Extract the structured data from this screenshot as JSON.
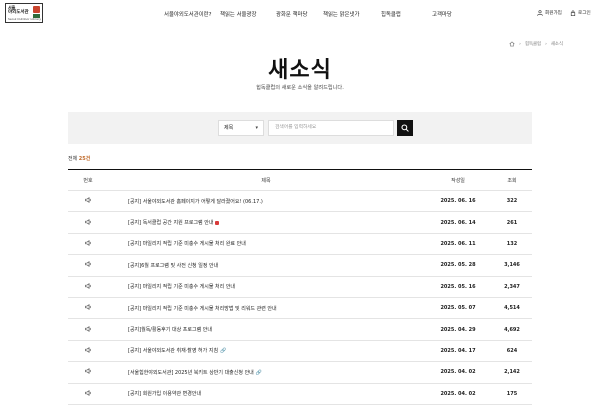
{
  "header": {
    "logo": {
      "line1": "서울",
      "line2": "야외도서관",
      "line3": "Seoul Outdoor Library"
    },
    "nav": [
      "서울야외도서관이란?",
      "책읽는 서울광장",
      "광화문 책마당",
      "책읽는 맑은냇가",
      "힙독클럽",
      "고객마당"
    ],
    "util": {
      "join": "회원가입",
      "login": "로그인"
    }
  },
  "breadcrumb": {
    "home_icon": "home-icon",
    "items": [
      "힙독클럽",
      "새소식"
    ]
  },
  "page": {
    "title": "새소식",
    "subtitle": "힙독클럽의 새로운 소식을 알려드립니다."
  },
  "search": {
    "select_value": "제목",
    "placeholder": "검색어를 입력하세요"
  },
  "total": {
    "prefix": "전체",
    "count": "25건"
  },
  "table": {
    "headers": {
      "no": "번호",
      "title": "제목",
      "date": "작성일",
      "views": "조회"
    },
    "rows": [
      {
        "title": "[공지] 서울야외도서관 홈페이지가 어떻게 달라졌어요! (06.17.)",
        "date": "2025. 06. 16",
        "views": "322",
        "badge": "",
        "clip": false
      },
      {
        "title": "[공지] 독서클럽 공간 지원 프로그램 안내",
        "date": "2025. 06. 14",
        "views": "261",
        "badge": "new",
        "clip": false
      },
      {
        "title": "[공지] 마일리지 적립 기준 미충수 게시물 처리 완료 안내",
        "date": "2025. 06. 11",
        "views": "132",
        "badge": "",
        "clip": false
      },
      {
        "title": "[공지]6월 프로그램 및 사전 신청 일정 안내",
        "date": "2025. 05. 28",
        "views": "3,146",
        "badge": "",
        "clip": false
      },
      {
        "title": "[공지] 마일리지 적립 기준 미충수 게시물 처리 안내",
        "date": "2025. 05. 16",
        "views": "2,347",
        "badge": "",
        "clip": false
      },
      {
        "title": "[공지] 마일리지 적립 기준 미충수 게시물 처리방법 및 리워드 관련 안내",
        "date": "2025. 05. 07",
        "views": "4,514",
        "badge": "",
        "clip": false
      },
      {
        "title": "[공지]월독/활동후기 대상 프로그램 안내",
        "date": "2025. 04. 29",
        "views": "4,692",
        "badge": "",
        "clip": false
      },
      {
        "title": "[공지] 서울야외도서관 취재·촬영 허가 지침",
        "date": "2025. 04. 17",
        "views": "624",
        "badge": "",
        "clip": true
      },
      {
        "title": "[서울힙한야외도서관] 2025년 북키트 상반기 대출신청 안내",
        "date": "2025. 04. 02",
        "views": "2,142",
        "badge": "",
        "clip": true
      },
      {
        "title": "[공지] 회원가입 이용약관 변경안내",
        "date": "2025. 04. 02",
        "views": "175",
        "badge": "",
        "clip": false
      }
    ]
  }
}
